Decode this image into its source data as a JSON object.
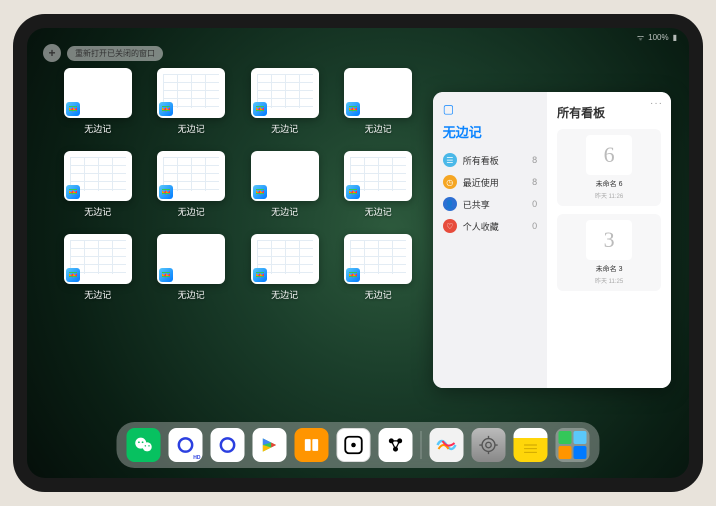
{
  "status": {
    "battery": "100%",
    "signal": "wifi"
  },
  "top": {
    "plus": "+",
    "reopen_label": "重新打开已关闭的窗口"
  },
  "app_label": "无边记",
  "grid_items": [
    {
      "label": "无边记",
      "variant": "blank"
    },
    {
      "label": "无边记",
      "variant": "grid"
    },
    {
      "label": "无边记",
      "variant": "grid"
    },
    {
      "label": "无边记",
      "variant": "blank"
    },
    {
      "label": "无边记",
      "variant": "grid"
    },
    {
      "label": "无边记",
      "variant": "grid"
    },
    {
      "label": "无边记",
      "variant": "blank"
    },
    {
      "label": "无边记",
      "variant": "grid"
    },
    {
      "label": "无边记",
      "variant": "grid"
    },
    {
      "label": "无边记",
      "variant": "blank"
    },
    {
      "label": "无边记",
      "variant": "grid"
    },
    {
      "label": "无边记",
      "variant": "grid"
    }
  ],
  "panel": {
    "left_title": "无边记",
    "right_title": "所有看板",
    "categories": [
      {
        "name": "所有看板",
        "count": "8",
        "color": "#4ab8e8",
        "glyph": "☰"
      },
      {
        "name": "最近使用",
        "count": "8",
        "color": "#f5a623",
        "glyph": "◷"
      },
      {
        "name": "已共享",
        "count": "0",
        "color": "#2d6fd2",
        "glyph": "👤"
      },
      {
        "name": "个人收藏",
        "count": "0",
        "color": "#e74c3c",
        "glyph": "♡"
      }
    ],
    "boards": [
      {
        "name": "未命名 6",
        "sub": "昨天 11:26",
        "sketch": "6"
      },
      {
        "name": "未命名 3",
        "sub": "昨天 11:25",
        "sketch": "3"
      }
    ]
  },
  "dock": [
    {
      "name": "wechat",
      "bg": "#07c160",
      "glyph": "💬"
    },
    {
      "name": "quark-hd",
      "bg": "#ffffff",
      "glyph_color": "#2b3fe0"
    },
    {
      "name": "quark",
      "bg": "#ffffff",
      "glyph_color": "#2b3fe0"
    },
    {
      "name": "play",
      "bg": "#ffffff"
    },
    {
      "name": "books",
      "bg": "#ff9500"
    },
    {
      "name": "dice",
      "bg": "#ffffff"
    },
    {
      "name": "connect",
      "bg": "#ffffff"
    },
    {
      "name": "freeform",
      "bg": "linear-gradient(135deg,#f8f8f8,#e8e8e8)"
    },
    {
      "name": "settings",
      "bg": "#8e8e93"
    },
    {
      "name": "notes",
      "bg": "#ffd60a"
    }
  ]
}
